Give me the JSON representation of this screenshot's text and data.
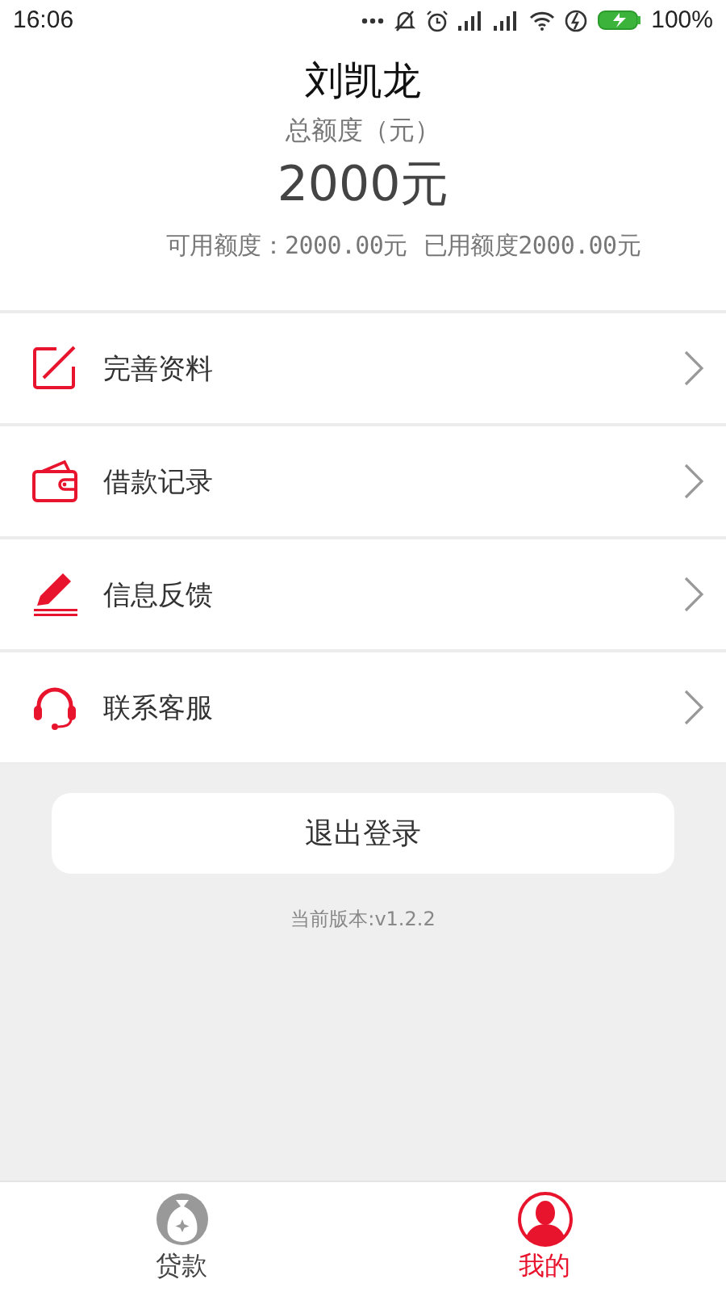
{
  "status_bar": {
    "time": "16:06",
    "battery": "100%"
  },
  "profile": {
    "name": "刘凯龙",
    "total_label": "总额度（元）",
    "total_amount": "2000元",
    "available": "可用额度：2000.00元",
    "used": "已用额度2000.00元"
  },
  "menu": [
    {
      "kind": "edit",
      "label": "完善资料"
    },
    {
      "kind": "wallet",
      "label": "借款记录"
    },
    {
      "kind": "pencil",
      "label": "信息反馈"
    },
    {
      "kind": "headset",
      "label": "联系客服"
    }
  ],
  "logout_button": "退出登录",
  "version": "当前版本:v1.2.2",
  "tabs": [
    {
      "kind": "moneybag",
      "label": "贷款",
      "selected": false
    },
    {
      "kind": "person",
      "label": "我的",
      "selected": true
    }
  ]
}
